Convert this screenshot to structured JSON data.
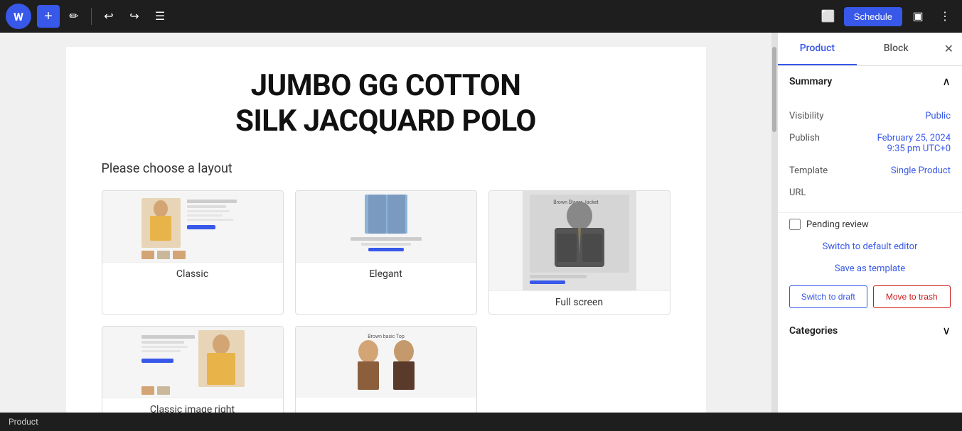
{
  "toolbar": {
    "add_label": "+",
    "schedule_label": "Schedule",
    "wp_logo": "W"
  },
  "editor": {
    "product_title_line1": "JUMBO GG COTTON",
    "product_title_line2": "SILK JACQUARD POLO",
    "layout_chooser_label": "Please choose a layout",
    "layouts": [
      {
        "id": "classic",
        "label": "Classic"
      },
      {
        "id": "elegant",
        "label": "Elegant"
      },
      {
        "id": "full-screen",
        "label": "Full screen"
      },
      {
        "id": "classic-image-right",
        "label": "Classic image right"
      }
    ]
  },
  "status_bar": {
    "text": "Product"
  },
  "sidebar": {
    "tabs": [
      {
        "id": "product",
        "label": "Product"
      },
      {
        "id": "block",
        "label": "Block"
      }
    ],
    "summary_section": {
      "title": "Summary",
      "rows": [
        {
          "label": "Visibility",
          "value": "Public"
        },
        {
          "label": "Publish",
          "value": "February 25, 2024\n9:35 pm UTC+0"
        },
        {
          "label": "Template",
          "value": "Single Product"
        },
        {
          "label": "URL",
          "value": ""
        }
      ]
    },
    "pending_review_label": "Pending review",
    "switch_default_editor_label": "Switch to default editor",
    "save_as_template_label": "Save as template",
    "switch_draft_label": "Switch to draft",
    "move_trash_label": "Move to trash",
    "categories_label": "Categories"
  }
}
